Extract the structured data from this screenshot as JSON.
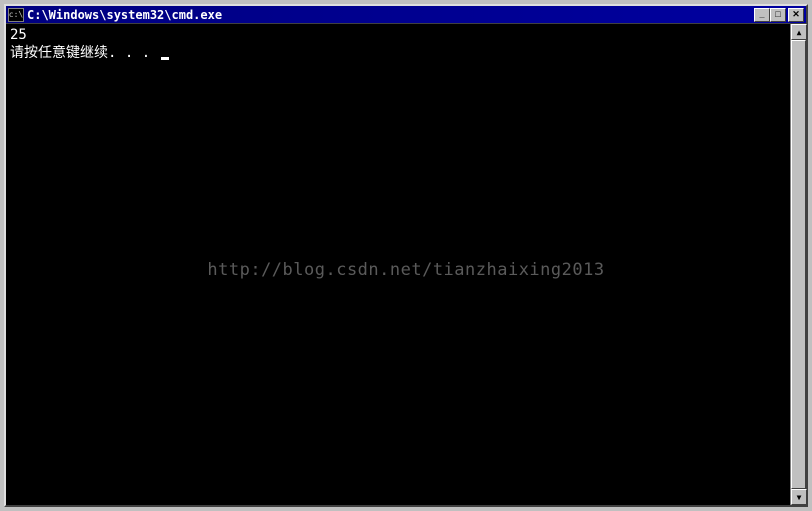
{
  "window": {
    "title": "C:\\Windows\\system32\\cmd.exe",
    "icon_label": "c:\\"
  },
  "terminal": {
    "line1": "25",
    "line2": "请按任意键继续. . . "
  },
  "watermark": "http://blog.csdn.net/tianzhaixing2013",
  "controls": {
    "minimize": "_",
    "maximize": "□",
    "close": "✕"
  },
  "scroll": {
    "up": "▲",
    "down": "▼"
  }
}
